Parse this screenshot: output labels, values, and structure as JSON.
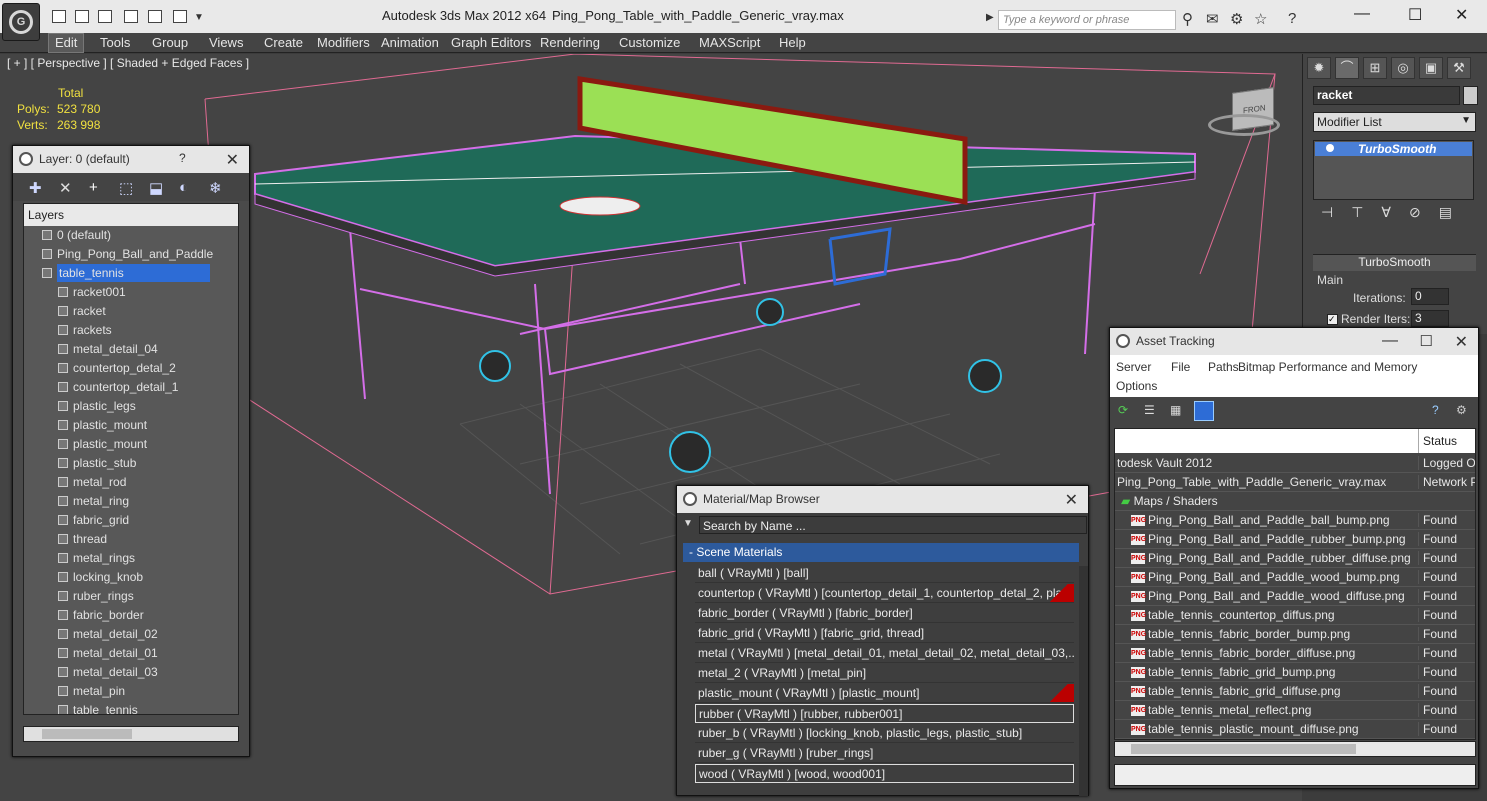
{
  "app": {
    "title": "Autodesk 3ds Max  2012 x64",
    "document": "Ping_Pong_Table_with_Paddle_Generic_vray.max",
    "search_placeholder": "Type a keyword or phrase",
    "logo_letter": "G"
  },
  "menus": [
    "Edit",
    "Tools",
    "Group",
    "Views",
    "Create",
    "Modifiers",
    "Animation",
    "Graph Editors",
    "Rendering",
    "Customize",
    "MAXScript",
    "Help"
  ],
  "viewport": {
    "label": "[ + ] [ Perspective ] [ Shaded + Edged Faces ]",
    "total_label": "Total",
    "polys_label": "Polys:",
    "polys_value": "523 780",
    "verts_label": "Verts:",
    "verts_value": "263 998",
    "cube_label": "FRON"
  },
  "command_panel": {
    "object_name": "racket",
    "modifier_list": "Modifier List",
    "modifier": "TurboSmooth",
    "rollout_title": "TurboSmooth",
    "main_label": "Main",
    "iterations_label": "Iterations:",
    "iterations_value": "0",
    "render_iters_label": "Render Iters:",
    "render_iters_value": "3"
  },
  "layer_panel": {
    "title": "Layer: 0 (default)",
    "help": "?",
    "header": "Layers",
    "rows": [
      {
        "label": "0 (default)",
        "type": "layer"
      },
      {
        "label": "Ping_Pong_Ball_and_Paddle",
        "type": "layer"
      },
      {
        "label": "table_tennis",
        "type": "layer",
        "selected": true
      },
      {
        "label": "racket001",
        "type": "obj"
      },
      {
        "label": "racket",
        "type": "obj"
      },
      {
        "label": "rackets",
        "type": "obj"
      },
      {
        "label": "metal_detail_04",
        "type": "obj"
      },
      {
        "label": "countertop_detal_2",
        "type": "obj"
      },
      {
        "label": "countertop_detail_1",
        "type": "obj"
      },
      {
        "label": "plastic_legs",
        "type": "obj"
      },
      {
        "label": "plastic_mount",
        "type": "obj"
      },
      {
        "label": "plastic_mount",
        "type": "obj"
      },
      {
        "label": "plastic_stub",
        "type": "obj"
      },
      {
        "label": "metal_rod",
        "type": "obj"
      },
      {
        "label": "metal_ring",
        "type": "obj"
      },
      {
        "label": "fabric_grid",
        "type": "obj"
      },
      {
        "label": "thread",
        "type": "obj"
      },
      {
        "label": "metal_rings",
        "type": "obj"
      },
      {
        "label": "locking_knob",
        "type": "obj"
      },
      {
        "label": "ruber_rings",
        "type": "obj"
      },
      {
        "label": "fabric_border",
        "type": "obj"
      },
      {
        "label": "metal_detail_02",
        "type": "obj"
      },
      {
        "label": "metal_detail_01",
        "type": "obj"
      },
      {
        "label": "metal_detail_03",
        "type": "obj"
      },
      {
        "label": "metal_pin",
        "type": "obj"
      },
      {
        "label": "table_tennis",
        "type": "obj"
      }
    ]
  },
  "material_browser": {
    "title": "Material/Map Browser",
    "search": "Search by Name ...",
    "section": "- Scene Materials",
    "rows": [
      "ball  ( VRayMtl ) [ball]",
      "countertop  ( VRayMtl ) [countertop_detail_1, countertop_detal_2, plast...",
      "fabric_border  ( VRayMtl ) [fabric_border]",
      "fabric_grid  ( VRayMtl ) [fabric_grid, thread]",
      "metal  ( VRayMtl ) [metal_detail_01, metal_detail_02, metal_detail_03,...",
      "metal_2  ( VRayMtl ) [metal_pin]",
      "plastic_mount  ( VRayMtl ) [plastic_mount]",
      "rubber  ( VRayMtl ) [rubber, rubber001]",
      "ruber_b  ( VRayMtl ) [locking_knob, plastic_legs, plastic_stub]",
      "ruber_g  ( VRayMtl ) [ruber_rings]",
      "wood  ( VRayMtl ) [wood, wood001]"
    ]
  },
  "asset_tracking": {
    "title": "Asset Tracking",
    "menus": [
      "Server",
      "File",
      "Paths",
      "Bitmap Performance and Memory",
      "Options"
    ],
    "status_header": "Status",
    "rows": [
      {
        "name": "todesk Vault 2012",
        "status": "Logged Out"
      },
      {
        "name": "Ping_Pong_Table_with_Paddle_Generic_vray.max",
        "status": "Network Pa"
      },
      {
        "name": "Maps / Shaders",
        "status": ""
      },
      {
        "name": "Ping_Pong_Ball_and_Paddle_ball_bump.png",
        "status": "Found"
      },
      {
        "name": "Ping_Pong_Ball_and_Paddle_rubber_bump.png",
        "status": "Found"
      },
      {
        "name": "Ping_Pong_Ball_and_Paddle_rubber_diffuse.png",
        "status": "Found"
      },
      {
        "name": "Ping_Pong_Ball_and_Paddle_wood_bump.png",
        "status": "Found"
      },
      {
        "name": "Ping_Pong_Ball_and_Paddle_wood_diffuse.png",
        "status": "Found"
      },
      {
        "name": "table_tennis_countertop_diffus.png",
        "status": "Found"
      },
      {
        "name": "table_tennis_fabric_border_bump.png",
        "status": "Found"
      },
      {
        "name": "table_tennis_fabric_border_diffuse.png",
        "status": "Found"
      },
      {
        "name": "table_tennis_fabric_grid_bump.png",
        "status": "Found"
      },
      {
        "name": "table_tennis_fabric_grid_diffuse.png",
        "status": "Found"
      },
      {
        "name": "table_tennis_metal_reflect.png",
        "status": "Found"
      },
      {
        "name": "table_tennis_plastic_mount_diffuse.png",
        "status": "Found"
      }
    ]
  },
  "colors": {
    "table_green": "#1f6a58",
    "wire_pink": "#d46ee8",
    "net_green": "#9be055",
    "net_red": "#8a1a10"
  }
}
